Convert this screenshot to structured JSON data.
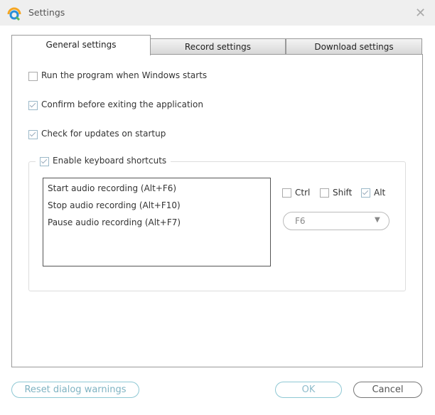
{
  "window": {
    "title": "Settings",
    "icon": "app-logo-icon",
    "close_icon": "close-icon"
  },
  "tabs": [
    {
      "label": "General settings",
      "active": true
    },
    {
      "label": "Record settings",
      "active": false
    },
    {
      "label": "Download settings",
      "active": false
    }
  ],
  "general": {
    "options": [
      {
        "label": "Run the program when Windows starts",
        "checked": false
      },
      {
        "label": "Confirm before exiting the application",
        "checked": true
      },
      {
        "label": "Check for updates on startup",
        "checked": true
      }
    ],
    "shortcuts": {
      "label": "Enable keyboard shortcuts",
      "checked": true,
      "items": [
        "Start audio recording (Alt+F6)",
        "Stop audio recording (Alt+F10)",
        "Pause audio recording (Alt+F7)"
      ],
      "modifiers": [
        {
          "label": "Ctrl",
          "checked": false
        },
        {
          "label": "Shift",
          "checked": false
        },
        {
          "label": "Alt",
          "checked": true
        }
      ],
      "key": "F6"
    }
  },
  "buttons": {
    "reset": "Reset dialog warnings",
    "ok": "OK",
    "cancel": "Cancel"
  },
  "colors": {
    "accent_border": "#8ec8d4",
    "accent_text": "#7fb3c2"
  }
}
